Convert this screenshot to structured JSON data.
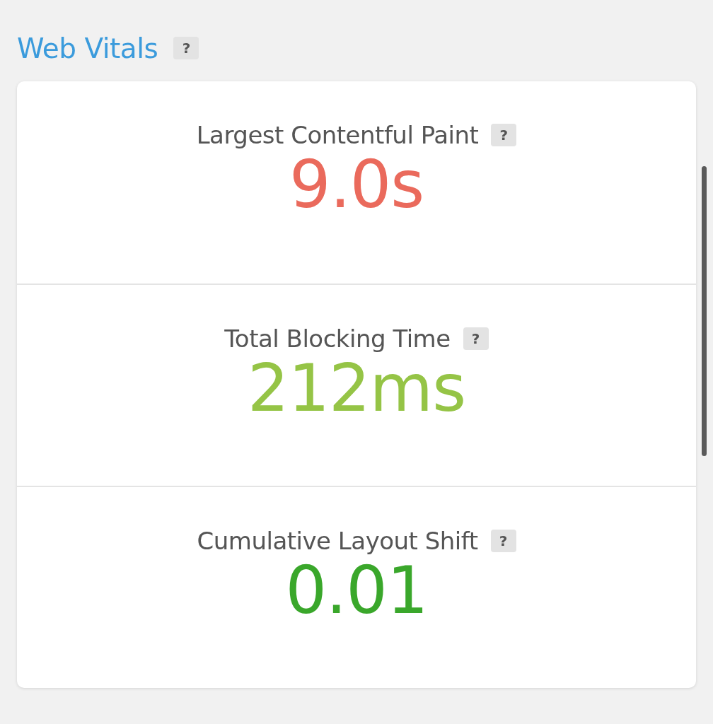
{
  "header": {
    "title": "Web Vitals",
    "help": "?"
  },
  "metrics": [
    {
      "label": "Largest Contentful Paint",
      "help": "?",
      "value": "9.0s",
      "color": "#ea6a5c"
    },
    {
      "label": "Total Blocking Time",
      "help": "?",
      "value": "212ms",
      "color": "#95c446"
    },
    {
      "label": "Cumulative Layout Shift",
      "help": "?",
      "value": "0.01",
      "color": "#3aa72b"
    }
  ]
}
